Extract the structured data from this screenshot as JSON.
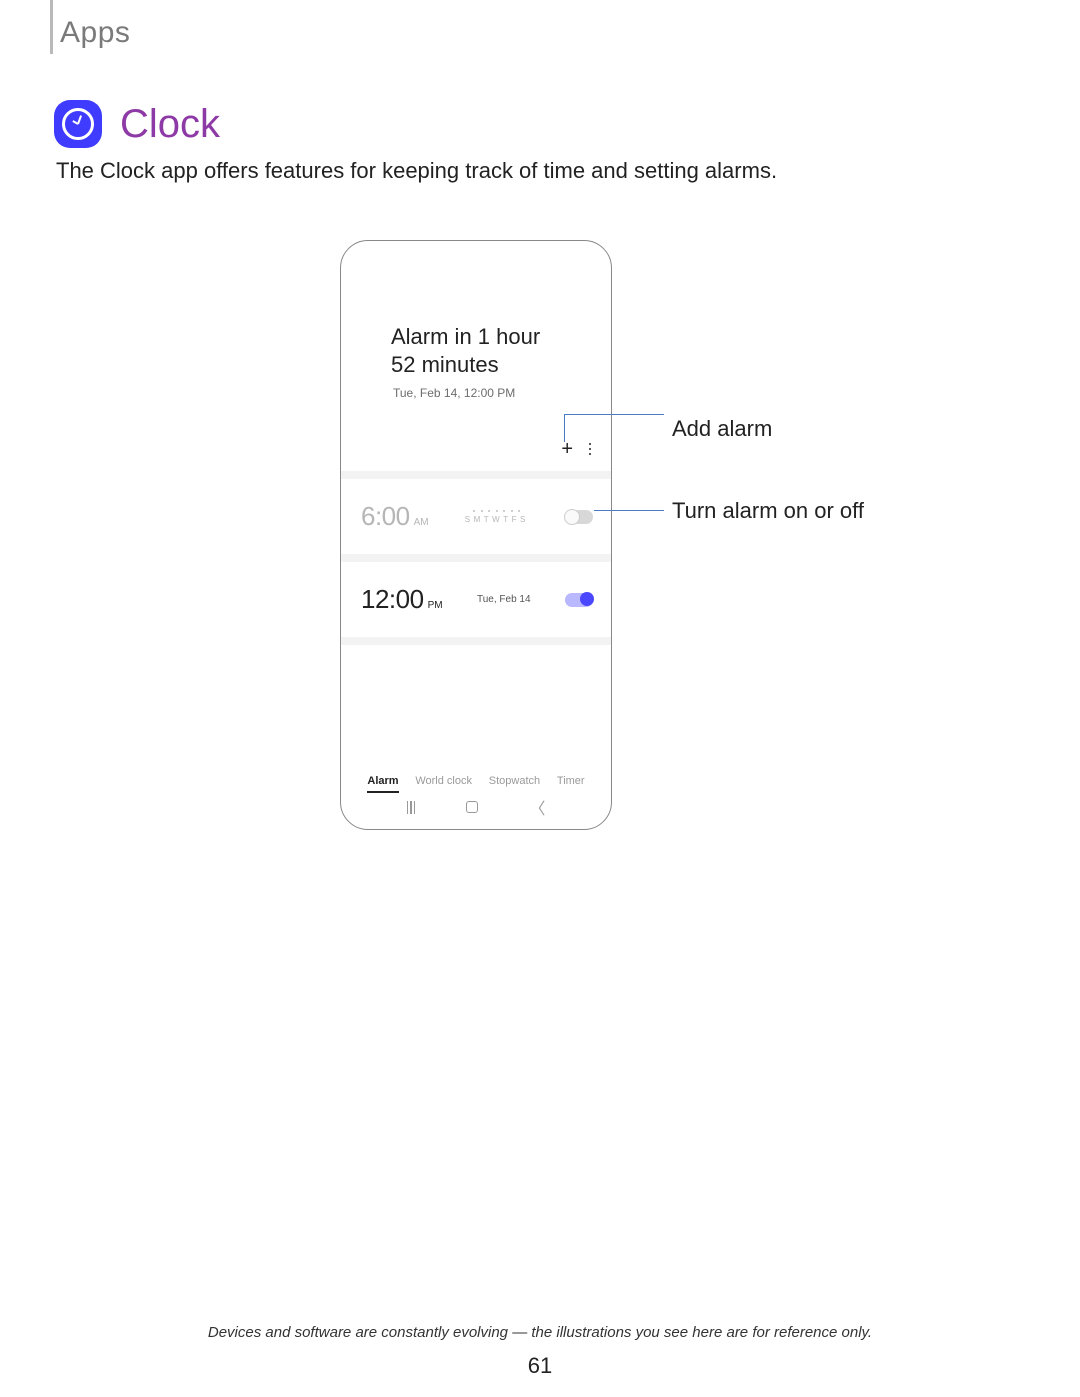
{
  "breadcrumb": "Apps",
  "title": "Clock",
  "intro": "The Clock app offers features for keeping track of time and setting alarms.",
  "phone": {
    "header": {
      "line1": "Alarm in 1 hour",
      "line2": "52 minutes",
      "date": "Tue, Feb 14, 12:00 PM"
    },
    "alarms": [
      {
        "time": "6:00",
        "ampm": "AM",
        "days": "SMTWTFS",
        "sublabel": "",
        "on": false
      },
      {
        "time": "12:00",
        "ampm": "PM",
        "days": "",
        "sublabel": "Tue, Feb 14",
        "on": true
      }
    ],
    "tabs": [
      "Alarm",
      "World clock",
      "Stopwatch",
      "Timer"
    ],
    "activeTab": "Alarm"
  },
  "callouts": {
    "add": "Add alarm",
    "toggle": "Turn alarm on or off"
  },
  "footer": "Devices and software are constantly evolving — the illustrations you see here are for reference only.",
  "pageNumber": "61"
}
